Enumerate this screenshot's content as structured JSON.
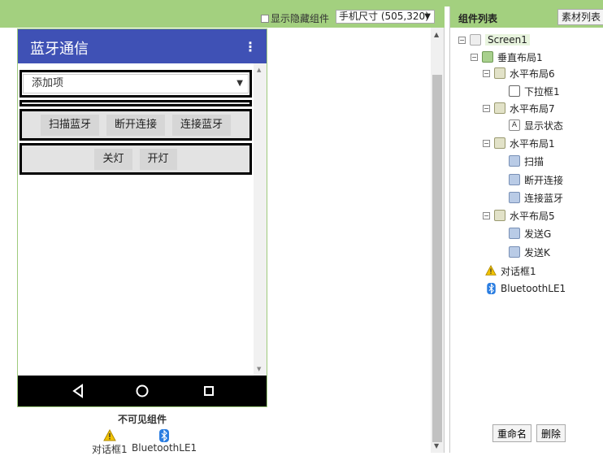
{
  "viewer": {
    "show_hidden_label": "显示隐藏组件",
    "size_select_value": "手机尺寸 (505,320)"
  },
  "phone": {
    "title": "蓝牙通信",
    "menu": "⋮",
    "dropdown_value": "添加项",
    "row1_buttons": [
      "扫描蓝牙",
      "断开连接",
      "连接蓝牙"
    ],
    "row2_buttons": [
      "关灯",
      "开灯"
    ]
  },
  "invisible": {
    "label": "不可见组件",
    "items": [
      "对话框1",
      "BluetoothLE1"
    ]
  },
  "tree": {
    "title": "组件列表",
    "assets_button": "素材列表",
    "items": [
      {
        "label": "Screen1",
        "toggle": "⊟"
      },
      {
        "label": "垂直布局1",
        "toggle": "⊟"
      },
      {
        "label": "水平布局6",
        "toggle": "⊟"
      },
      {
        "label": "下拉框1"
      },
      {
        "label": "水平布局7",
        "toggle": "⊟"
      },
      {
        "label": "显示状态"
      },
      {
        "label": "水平布局1",
        "toggle": "⊟"
      },
      {
        "label": "扫描"
      },
      {
        "label": "断开连接"
      },
      {
        "label": "连接蓝牙"
      },
      {
        "label": "水平布局5",
        "toggle": "⊟"
      },
      {
        "label": "发送G"
      },
      {
        "label": "发送K"
      },
      {
        "label": "对话框1"
      },
      {
        "label": "BluetoothLE1"
      }
    ],
    "rename_button": "重命名",
    "delete_button": "删除"
  },
  "colors": {
    "header_green": "#a3d07f",
    "appbar_blue": "#3f51b5"
  }
}
